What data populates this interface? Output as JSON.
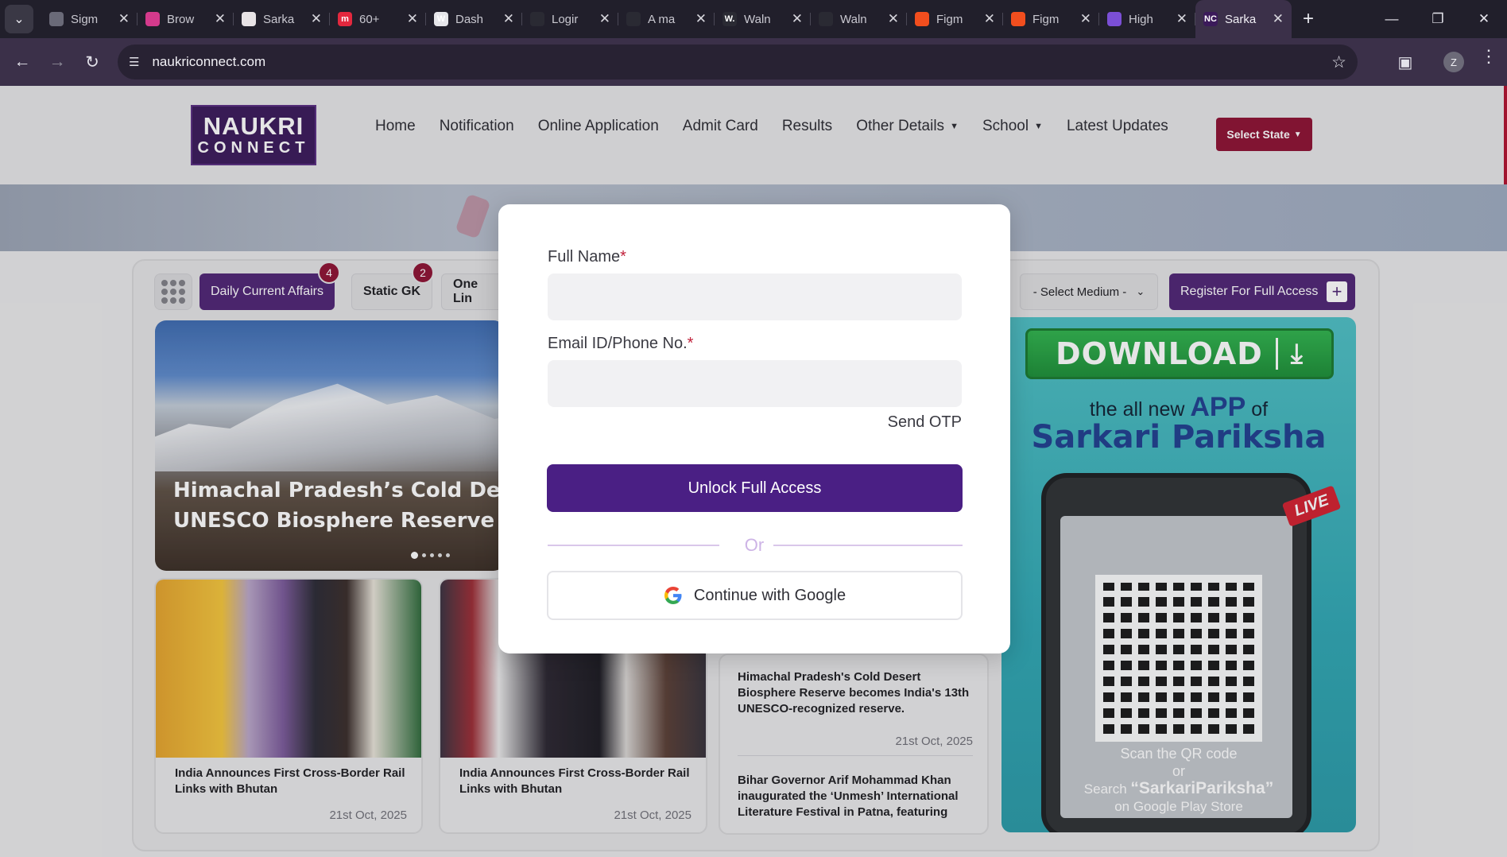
{
  "browser": {
    "tabs": [
      {
        "label": "Sigm",
        "favicon_color": "#6a6a78",
        "favicon_glyph": ""
      },
      {
        "label": "Brow",
        "favicon_color": "#d43a8c",
        "favicon_glyph": ""
      },
      {
        "label": "Sarka",
        "favicon_color": "#e8e3e6",
        "favicon_glyph": ""
      },
      {
        "label": "60+",
        "favicon_color": "#e3283e",
        "favicon_glyph": "m"
      },
      {
        "label": "Dash",
        "favicon_color": "#e6e6ea",
        "favicon_glyph": "W"
      },
      {
        "label": "Logir",
        "favicon_color": "#2a2a33",
        "favicon_glyph": ""
      },
      {
        "label": "A ma",
        "favicon_color": "#2a2a33",
        "favicon_glyph": ""
      },
      {
        "label": "Waln",
        "favicon_color": "#2a2a33",
        "favicon_glyph": "W."
      },
      {
        "label": "Waln",
        "favicon_color": "#2a2a33",
        "favicon_glyph": ""
      },
      {
        "label": "Figm",
        "favicon_color": "#f24e1e",
        "favicon_glyph": ""
      },
      {
        "label": "Figm",
        "favicon_color": "#f24e1e",
        "favicon_glyph": ""
      },
      {
        "label": "High",
        "favicon_color": "#7b4fd6",
        "favicon_glyph": ""
      },
      {
        "label": "Sarka",
        "favicon_color": "#3b1a5a",
        "favicon_glyph": "NC",
        "active": true
      }
    ],
    "url": "naukriconnect.com",
    "profile_initial": "Z"
  },
  "site": {
    "logo_line1": "NAUKRI",
    "logo_line2": "CONNECT",
    "nav": [
      {
        "label": "Home",
        "dropdown": false
      },
      {
        "label": "Notification",
        "dropdown": false
      },
      {
        "label": "Online Application",
        "dropdown": false
      },
      {
        "label": "Admit Card",
        "dropdown": false
      },
      {
        "label": "Results",
        "dropdown": false
      },
      {
        "label": "Other Details",
        "dropdown": true
      },
      {
        "label": "School",
        "dropdown": true
      },
      {
        "label": "Latest Updates",
        "dropdown": false
      }
    ],
    "select_state": "Select State"
  },
  "filters": {
    "daily_current_affairs": "Daily Current Affairs",
    "daily_badge": "4",
    "static_gk": "Static GK",
    "static_badge": "2",
    "one_liner": "One Lin",
    "select_medium": "- Select Medium -",
    "register": "Register For Full Access"
  },
  "hero": {
    "title_line1": "Himachal Pradesh’s Cold Desert R",
    "title_line2": "UNESCO Biosphere Reserve"
  },
  "cards": [
    {
      "title": "India Announces First Cross-Border Rail Links with Bhutan",
      "date": "21st Oct, 2025"
    },
    {
      "title": "India Announces First Cross-Border Rail Links with Bhutan",
      "date": "21st Oct, 2025"
    }
  ],
  "list": {
    "item1": "Himachal Pradesh's Cold Desert Biosphere Reserve becomes India's 13th UNESCO-recognized reserve.",
    "item1_date": "21st Oct, 2025",
    "item2": "Bihar Governor Arif Mohammad Khan inaugurated the ‘Unmesh’ International Literature Festival in Patna, featuring"
  },
  "ad": {
    "download": "DOWNLOAD",
    "tag_pre": "the all new",
    "tag_app": "APP",
    "tag_post": "of",
    "brand": "Sarkari Pariksha",
    "live": "LIVE",
    "scan_line1": "Scan the QR code",
    "scan_line2": "or",
    "search_pre": "Search",
    "search_term": "“SarkariPariksha”",
    "search_line2": "on Google Play Store"
  },
  "modal": {
    "full_name_label": "Full Name",
    "email_label": "Email ID/Phone No.",
    "required_mark": "*",
    "full_name_value": "",
    "email_value": "",
    "send_otp": "Send OTP",
    "unlock": "Unlock Full Access",
    "or": "Or",
    "google": "Continue with Google"
  },
  "colors": {
    "brand_purple": "#4a1f84",
    "accent_red": "#8e1233"
  }
}
